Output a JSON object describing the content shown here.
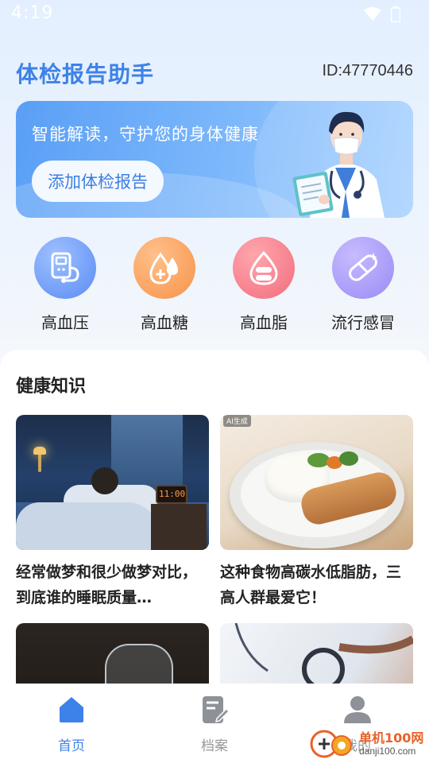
{
  "status_bar": {
    "time": "4:19"
  },
  "header": {
    "title": "体检报告助手",
    "user_id": "ID:47770446"
  },
  "banner": {
    "slogan": "智能解读，守护您的身体健康",
    "button_label": "添加体检报告"
  },
  "categories": [
    {
      "label": "高血压",
      "icon": "blood-pressure-monitor-icon",
      "color": "#5b8cf5"
    },
    {
      "label": "高血糖",
      "icon": "blood-drop-plus-icon",
      "color": "#f7934a"
    },
    {
      "label": "高血脂",
      "icon": "blood-drop-pill-icon",
      "color": "#f26d7d"
    },
    {
      "label": "流行感冒",
      "icon": "capsule-icon",
      "color": "#9a8af5"
    }
  ],
  "knowledge": {
    "title": "健康知识",
    "articles": [
      {
        "title": "经常做梦和很少做梦对比，到底谁的睡眠质量…"
      },
      {
        "title": "这种食物高碳水低脂肪，三高人群最爱它！",
        "badge": "AI生成"
      },
      {
        "title": ""
      },
      {
        "title": ""
      }
    ],
    "clock_text": "11:00"
  },
  "nav": {
    "items": [
      {
        "label": "首页",
        "icon": "home-icon",
        "active": true
      },
      {
        "label": "档案",
        "icon": "document-edit-icon",
        "active": false
      },
      {
        "label": "我的",
        "icon": "person-icon",
        "active": false
      }
    ]
  },
  "watermark": {
    "text": "单机100网",
    "sub": "danji100.com"
  },
  "colors": {
    "accent": "#3d82e8",
    "nav_active": "#3d82e8",
    "nav_inactive": "#999999"
  }
}
